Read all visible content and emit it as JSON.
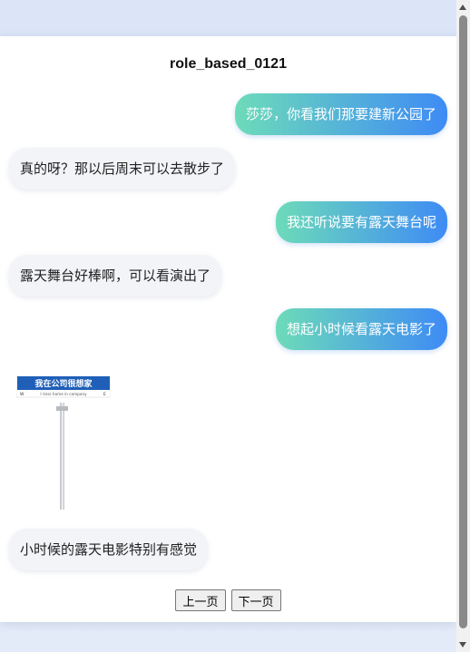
{
  "title": "role_based_0121",
  "messages": [
    {
      "role": "user",
      "text": "莎莎，你看我们那要建新公园了"
    },
    {
      "role": "bot",
      "text": "真的呀？那以后周末可以去散步了"
    },
    {
      "role": "user",
      "text": "我还听说要有露天舞台呢"
    },
    {
      "role": "bot",
      "text": "露天舞台好棒啊，可以看演出了"
    },
    {
      "role": "user",
      "text": "想起小时候看露天电影了"
    },
    {
      "role": "bot",
      "text": "小时候的露天电影特别有感觉"
    }
  ],
  "image": {
    "sign_text": "我在公司很想家",
    "sign_subtext": "I miss home in company",
    "sign_color": "#1f5fb8"
  },
  "pager": {
    "prev_label": "上一页",
    "next_label": "下一页"
  },
  "colors": {
    "user_gradient_start": "#6ddbb9",
    "user_gradient_end": "#3e8bf5",
    "bot_bubble": "#f2f4f8",
    "background": "#dde6f6"
  }
}
